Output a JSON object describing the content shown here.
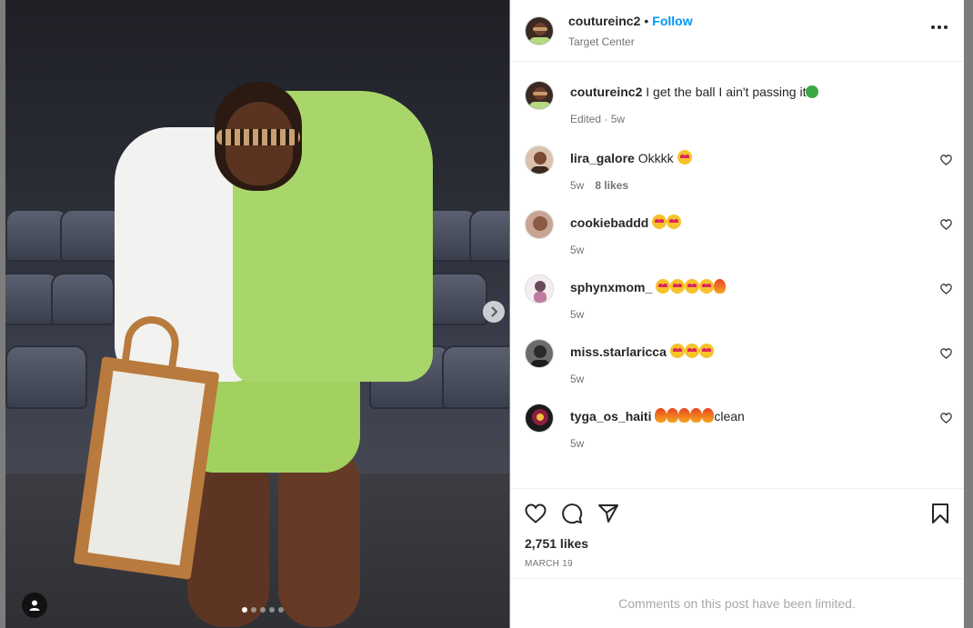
{
  "post": {
    "username": "coutureinc2",
    "follow_label": "Follow",
    "separator": "•",
    "location": "Target Center",
    "caption": {
      "username": "coutureinc2",
      "text": "I get the ball I ain't passing it",
      "meta": "Edited · 5w"
    },
    "likes": "2,751 likes",
    "date": "MARCH 19",
    "comments_limited": "Comments on this post have been limited.",
    "carousel": {
      "total": 5,
      "active_index": 0
    }
  },
  "comments": [
    {
      "username": "lira_galore",
      "text": "Okkkk",
      "emoji": [
        "heart-eyes"
      ],
      "time": "5w",
      "likes": "8 likes"
    },
    {
      "username": "cookiebaddd",
      "text": "",
      "emoji": [
        "heart-eyes",
        "heart-eyes"
      ],
      "time": "5w",
      "likes": ""
    },
    {
      "username": "sphynxmom_",
      "text": "",
      "emoji": [
        "heart-eyes",
        "heart-eyes",
        "heart-eyes",
        "heart-eyes",
        "fire"
      ],
      "time": "5w",
      "likes": ""
    },
    {
      "username": "miss.starlaricca",
      "text": "",
      "emoji": [
        "heart-eyes",
        "heart-eyes",
        "heart-eyes"
      ],
      "time": "5w",
      "likes": ""
    },
    {
      "username": "tyga_os_haiti",
      "text": "clean",
      "emoji": [
        "fire",
        "fire",
        "fire",
        "fire",
        "fire"
      ],
      "time": "5w",
      "likes": ""
    }
  ],
  "colors": {
    "link": "#0095f6",
    "text": "#262626",
    "secondary": "#737373",
    "muted": "#a8a8a8"
  },
  "icons": [
    "heart-icon",
    "comment-icon",
    "share-icon",
    "bookmark-icon",
    "more-icon",
    "chevron-right-icon",
    "user-tag-icon"
  ]
}
